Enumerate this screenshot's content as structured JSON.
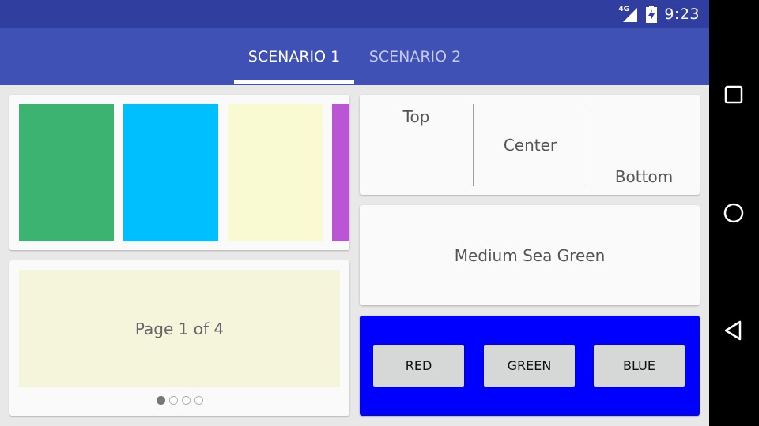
{
  "status_bar": {
    "network": "4G",
    "time": "9:23",
    "signal_icon": "signal-icon",
    "battery_icon": "battery-charging-icon"
  },
  "tabs": [
    {
      "label": "SCENARIO 1",
      "selected": true
    },
    {
      "label": "SCENARIO 2",
      "selected": false
    }
  ],
  "colors_card": {
    "swatches": [
      {
        "name": "green-swatch",
        "color": "#3cb371"
      },
      {
        "name": "blue-swatch",
        "color": "#00bfff"
      },
      {
        "name": "yellow-swatch",
        "color": "#fafad2"
      },
      {
        "name": "purple-swatch",
        "color": "#ba55d3"
      }
    ]
  },
  "pager_card": {
    "page_text": "Page 1 of 4",
    "page_count": 4,
    "current_page": 1
  },
  "align_card": {
    "top": "Top",
    "center": "Center",
    "bottom": "Bottom"
  },
  "text_card": {
    "label": "Medium Sea Green"
  },
  "buttons_card": {
    "background": "#0000ff",
    "buttons": [
      "RED",
      "GREEN",
      "BLUE"
    ]
  },
  "nav_bar": {
    "icons": [
      "recents-icon",
      "home-icon",
      "back-icon"
    ]
  }
}
